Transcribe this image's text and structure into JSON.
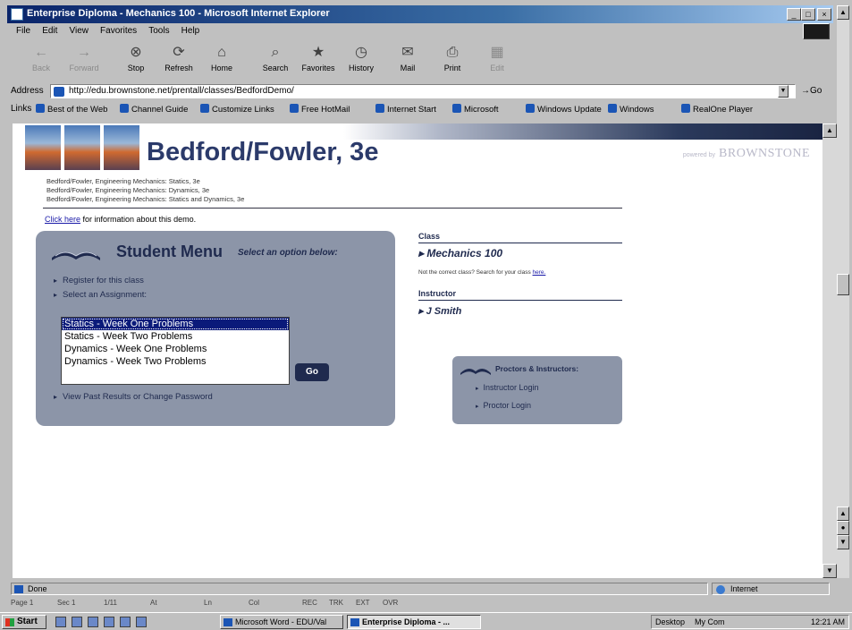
{
  "window": {
    "title": "Enterprise Diploma - Mechanics 100 - Microsoft Internet Explorer",
    "buttons": [
      "_",
      "□",
      "×"
    ]
  },
  "menu": [
    "File",
    "Edit",
    "View",
    "Favorites",
    "Tools",
    "Help"
  ],
  "toolbar": [
    {
      "label": "Back",
      "icon": "back-arrow-icon",
      "glyph": "←",
      "disabled": true
    },
    {
      "label": "Forward",
      "icon": "forward-arrow-icon",
      "glyph": "→",
      "disabled": true
    },
    {
      "label": "Stop",
      "icon": "stop-icon",
      "glyph": "⊗",
      "disabled": false
    },
    {
      "label": "Refresh",
      "icon": "refresh-icon",
      "glyph": "⟳",
      "disabled": false
    },
    {
      "label": "Home",
      "icon": "home-icon",
      "glyph": "⌂",
      "disabled": false
    },
    {
      "label": "Search",
      "icon": "search-icon",
      "glyph": "⌕",
      "disabled": false
    },
    {
      "label": "Favorites",
      "icon": "favorites-icon",
      "glyph": "★",
      "disabled": false
    },
    {
      "label": "History",
      "icon": "history-icon",
      "glyph": "◷",
      "disabled": false
    },
    {
      "label": "Mail",
      "icon": "mail-icon",
      "glyph": "✉",
      "disabled": false
    },
    {
      "label": "Print",
      "icon": "print-icon",
      "glyph": "⎙",
      "disabled": false
    },
    {
      "label": "Edit",
      "icon": "edit-icon",
      "glyph": "▦",
      "disabled": true
    }
  ],
  "address": {
    "label": "Address",
    "url": "http://edu.brownstone.net/prentall/classes/BedfordDemo/",
    "go": "Go"
  },
  "links": {
    "label": "Links",
    "items": [
      "Best of the Web",
      "Channel Guide",
      "Customize Links",
      "Free HotMail",
      "Internet Start",
      "Microsoft",
      "Windows Update",
      "Windows",
      "RealOne Player"
    ]
  },
  "page": {
    "course_title": "Bedford/Fowler, 3e",
    "powered_by": "powered by",
    "brand": "BROWNSTONE",
    "sublines": [
      "Bedford/Fowler, Engineering Mechanics: Statics, 3e",
      "Bedford/Fowler, Engineering Mechanics: Dynamics, 3e",
      "Bedford/Fowler, Engineering Mechanics: Statics and Dynamics, 3e"
    ],
    "click_here": "Click here",
    "click_here_rest": " for information about this demo.",
    "student_menu": {
      "title": "Student Menu",
      "select_prompt": "Select an option below:",
      "register": "Register for this class",
      "select_assignment": "Select an Assignment:",
      "assignments": [
        "Statics - Week One Problems",
        "Statics - Week Two Problems",
        "Dynamics - Week One Problems",
        "Dynamics - Week Two Problems"
      ],
      "selected_index": 0,
      "go_label": "Go",
      "view_results": "View Past Results or Change Password"
    },
    "class": {
      "label": "Class",
      "name": "Mechanics 100",
      "wrong_class_text": "Not the correct class? Search for your class ",
      "wrong_class_link": "here."
    },
    "instructor": {
      "label": "Instructor",
      "name": "J Smith"
    },
    "proctors": {
      "title": "Proctors & Instructors:",
      "instructor_login": "Instructor Login",
      "proctor_login": "Proctor Login"
    }
  },
  "status": {
    "text": "Done",
    "zone": "Internet"
  },
  "word_status": [
    "Page 1",
    "Sec 1",
    "1/11",
    "At",
    "Ln",
    "Col",
    "REC",
    "TRK",
    "EXT",
    "OVR"
  ],
  "taskbar": {
    "start": "Start",
    "tasks": [
      "Microsoft Word - EDU/Val",
      "Enterprise Diploma - ..."
    ],
    "tray_items": [
      "Desktop",
      "My Com"
    ],
    "clock": "12:21 AM"
  }
}
